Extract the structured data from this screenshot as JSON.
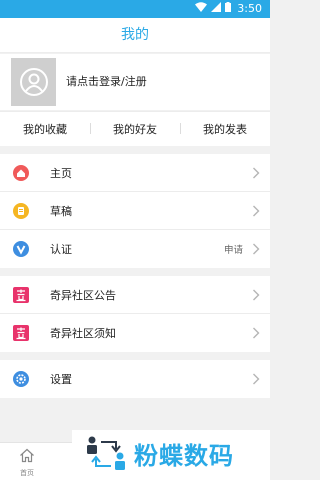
{
  "status_bar": {
    "time": "3:50"
  },
  "header": {
    "title": "我的"
  },
  "profile": {
    "login_prompt": "请点击登录/注册"
  },
  "tabs": [
    {
      "label": "我的收藏"
    },
    {
      "label": "我的好友"
    },
    {
      "label": "我的发表"
    }
  ],
  "menu_group_1": [
    {
      "label": "主页",
      "icon": "home-icon",
      "color": "#f05a5a"
    },
    {
      "label": "草稿",
      "icon": "draft-icon",
      "color": "#f5b623"
    },
    {
      "label": "认证",
      "icon": "verify-icon",
      "color": "#3e8ee0",
      "extra": "申请"
    }
  ],
  "menu_group_2": [
    {
      "label": "奇异社区公告",
      "icon": "qi-logo-icon",
      "color": "#e8336b"
    },
    {
      "label": "奇异社区须知",
      "icon": "qi-logo-icon",
      "color": "#e8336b"
    }
  ],
  "menu_group_3": [
    {
      "label": "设置",
      "icon": "settings-icon",
      "color": "#3e8ee0"
    }
  ],
  "bottom_nav": {
    "home_label": "首页"
  },
  "watermark": {
    "text": "粉蝶数码"
  },
  "theme": {
    "accent": "#2aa9e6",
    "background": "#f1f1f1"
  }
}
